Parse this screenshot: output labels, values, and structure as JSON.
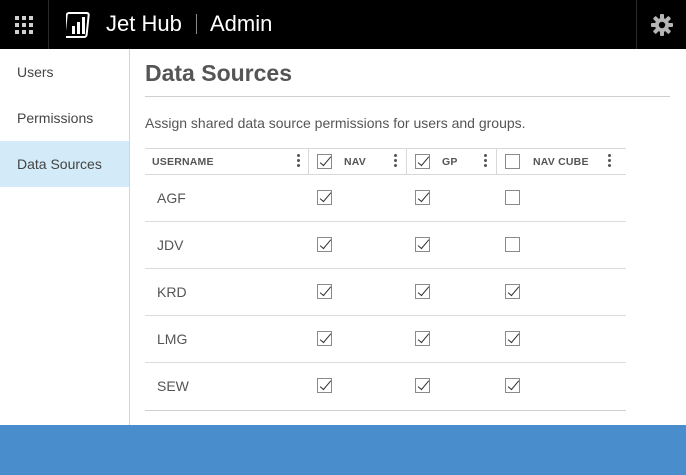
{
  "header": {
    "app_title": "Jet Hub",
    "app_subtitle": "Admin",
    "apps_icon": "grid-icon",
    "settings_icon": "gear-icon"
  },
  "sidebar": {
    "items": [
      {
        "label": "Users",
        "active": false
      },
      {
        "label": "Permissions",
        "active": false
      },
      {
        "label": "Data Sources",
        "active": true
      }
    ]
  },
  "main": {
    "title": "Data Sources",
    "description": "Assign shared data source permissions for users and groups."
  },
  "table": {
    "columns": [
      {
        "label": "USERNAME"
      },
      {
        "label": "NAV",
        "header_checked": true
      },
      {
        "label": "GP",
        "header_checked": true
      },
      {
        "label": "NAV CUBE",
        "header_checked": false
      }
    ],
    "rows": [
      {
        "username": "AGF",
        "nav": true,
        "gp": true,
        "nav_cube": false
      },
      {
        "username": "JDV",
        "nav": true,
        "gp": true,
        "nav_cube": false
      },
      {
        "username": "KRD",
        "nav": true,
        "gp": true,
        "nav_cube": true
      },
      {
        "username": "LMG",
        "nav": true,
        "gp": true,
        "nav_cube": true
      },
      {
        "username": "SEW",
        "nav": true,
        "gp": true,
        "nav_cube": true
      }
    ]
  },
  "colors": {
    "topbar": "#000000",
    "active_sidebar": "#d3ebf8",
    "footer": "#4a8dcd"
  }
}
